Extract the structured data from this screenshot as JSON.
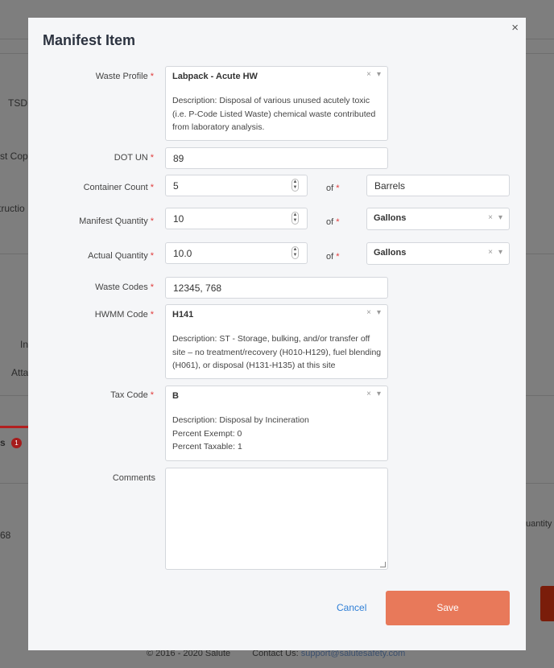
{
  "background": {
    "tsdf": "TSDF",
    "copy": "st Copy",
    "instruction": "tructio",
    "in": "In",
    "atta": "Atta",
    "tab_suffix": "s",
    "tab_badge": "1",
    "row_value": "68",
    "quantity_header": "uantity",
    "footer_copyright": "© 2016 - 2020 Salute",
    "footer_contact_label": "Contact Us:",
    "footer_contact_email": "support@salutesafety.com"
  },
  "modal": {
    "title": "Manifest Item",
    "close": "×"
  },
  "form": {
    "waste_profile": {
      "label": "Waste Profile",
      "value": "Labpack - Acute HW",
      "description": "Description: Disposal of various unused acutely toxic (i.e. P-Code Listed Waste) chemical waste contributed from laboratory analysis."
    },
    "dot_un": {
      "label": "DOT UN",
      "value": "89"
    },
    "container_count": {
      "label": "Container Count",
      "value": "5",
      "of_label": "of",
      "unit": "Barrels"
    },
    "manifest_quantity": {
      "label": "Manifest Quantity",
      "value": "10",
      "of_label": "of",
      "unit": "Gallons"
    },
    "actual_quantity": {
      "label": "Actual Quantity",
      "value": "10.0",
      "of_label": "of",
      "unit": "Gallons"
    },
    "waste_codes": {
      "label": "Waste Codes",
      "value": "12345, 768"
    },
    "hwmm_code": {
      "label": "HWMM Code",
      "value": "H141",
      "description": "Description: ST - Storage, bulking, and/or transfer off site – no treatment/recovery (H010-H129), fuel blending (H061), or disposal (H131-H135) at this site"
    },
    "tax_code": {
      "label": "Tax Code",
      "value": "B",
      "description": "Description: Disposal by Incineration",
      "percent_exempt": "Percent Exempt: 0",
      "percent_taxable": "Percent Taxable: 1"
    },
    "comments": {
      "label": "Comments",
      "value": ""
    },
    "required_mark": "*"
  },
  "actions": {
    "cancel": "Cancel",
    "save": "Save"
  },
  "colors": {
    "save": "#e8795a",
    "link": "#2f7fd6",
    "required": "#e03b3b"
  }
}
